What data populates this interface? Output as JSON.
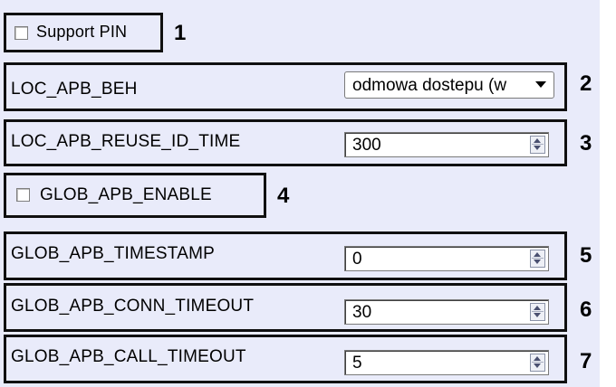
{
  "support_pin": {
    "label": "Support PIN",
    "checked": false,
    "marker": "1"
  },
  "loc_apb_beh": {
    "label": "LOC_APB_BEH",
    "value": "odmowa dostepu (w",
    "marker": "2"
  },
  "loc_apb_reuse_id_time": {
    "label": "LOC_APB_REUSE_ID_TIME",
    "value": "300",
    "marker": "3"
  },
  "glob_apb_enable": {
    "label": "GLOB_APB_ENABLE",
    "checked": false,
    "marker": "4"
  },
  "glob_apb_timestamp": {
    "label": "GLOB_APB_TIMESTAMP",
    "value": "0",
    "marker": "5"
  },
  "glob_apb_conn_timeout": {
    "label": "GLOB_APB_CONN_TIMEOUT",
    "value": "30",
    "marker": "6"
  },
  "glob_apb_call_timeout": {
    "label": "GLOB_APB_CALL_TIMEOUT",
    "value": "5",
    "marker": "7"
  },
  "colors": {
    "panel_bg": "#e9ebfa",
    "highlight_border": "#101010"
  }
}
